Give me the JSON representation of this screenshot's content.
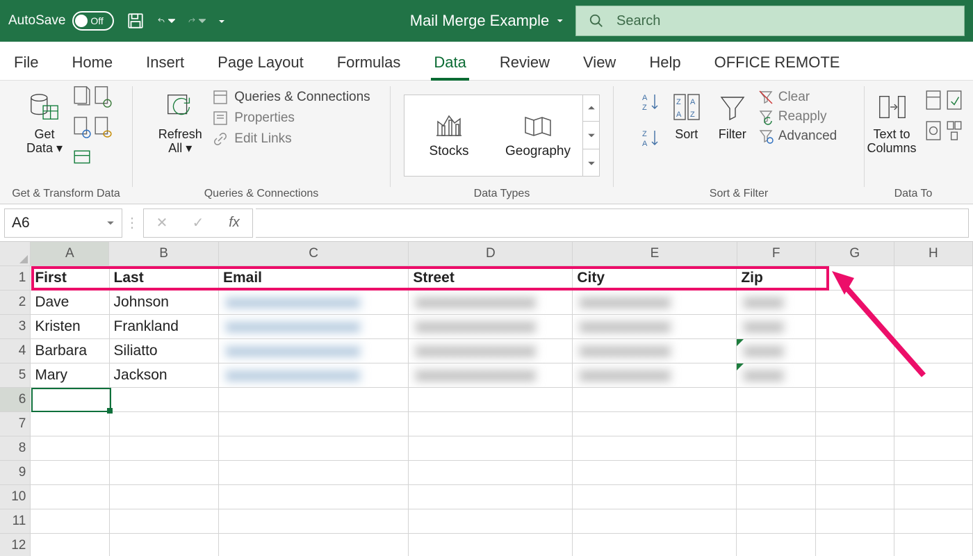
{
  "titlebar": {
    "autosave_label": "AutoSave",
    "autosave_state": "Off",
    "document_title": "Mail Merge Example",
    "search_placeholder": "Search"
  },
  "tabs": [
    "File",
    "Home",
    "Insert",
    "Page Layout",
    "Formulas",
    "Data",
    "Review",
    "View",
    "Help",
    "OFFICE REMOTE"
  ],
  "active_tab": "Data",
  "ribbon": {
    "groups": {
      "get_transform": {
        "label": "Get & Transform Data",
        "get_data": "Get\nData"
      },
      "queries": {
        "label": "Queries & Connections",
        "refresh": "Refresh\nAll",
        "q_and_c": "Queries & Connections",
        "properties": "Properties",
        "edit_links": "Edit Links"
      },
      "data_types": {
        "label": "Data Types",
        "stocks": "Stocks",
        "geography": "Geography"
      },
      "sort_filter": {
        "label": "Sort & Filter",
        "sort": "Sort",
        "filter": "Filter",
        "clear": "Clear",
        "reapply": "Reapply",
        "advanced": "Advanced"
      },
      "data_tools": {
        "label": "Data Tools",
        "text_to_cols": "Text to\nColumns"
      }
    }
  },
  "formula_bar": {
    "cell_ref": "A6",
    "fx_label": "fx"
  },
  "columns": [
    "A",
    "B",
    "C",
    "D",
    "E",
    "F",
    "G",
    "H"
  ],
  "column_widths": {
    "A": 115,
    "B": 160,
    "C": 278,
    "D": 240,
    "E": 240,
    "F": 115,
    "G": 115,
    "H": 115
  },
  "sheet": {
    "headers": [
      "First",
      "Last",
      "Email",
      "Street",
      "City",
      "Zip"
    ],
    "rows": [
      {
        "first": "Dave",
        "last": "Johnson",
        "email": "(redacted)",
        "street": "(redacted)",
        "city": "(redacted)",
        "zip": "(redacted)"
      },
      {
        "first": "Kristen",
        "last": "Frankland",
        "email": "(redacted)",
        "street": "(redacted)",
        "city": "(redacted)",
        "zip": "(redacted)"
      },
      {
        "first": "Barbara",
        "last": "Siliatto",
        "email": "(redacted)",
        "street": "(redacted)",
        "city": "(redacted)",
        "zip": "(redacted)",
        "zip_err": true
      },
      {
        "first": "Mary",
        "last": "Jackson",
        "email": "(redacted)",
        "street": "(redacted)",
        "city": "(redacted)",
        "zip": "(redacted)",
        "zip_err": true
      }
    ],
    "blank_rows": [
      6,
      7,
      8,
      9,
      10,
      11,
      12
    ],
    "selected_cell": "A6"
  },
  "annotation": {
    "highlight": "header-row",
    "arrow": "points-to-header-row"
  }
}
